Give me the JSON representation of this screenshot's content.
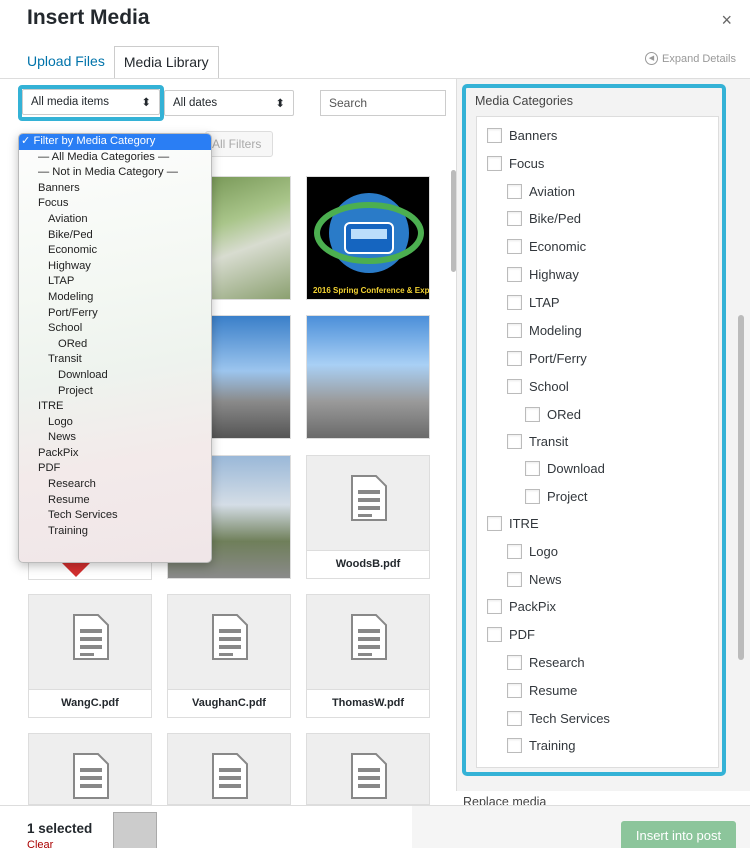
{
  "header": {
    "title": "Insert Media",
    "close": "×"
  },
  "tabs": [
    {
      "label": "Upload Files"
    },
    {
      "label": "Media Library"
    }
  ],
  "expand_details": "Expand Details",
  "toolbar": {
    "media_type": "All media items",
    "date_filter": "All dates",
    "search_placeholder": "Search",
    "filters_button": "All Filters",
    "arrow": "⬍"
  },
  "dropdown": {
    "selected": "✓ Filter by Media Category",
    "items": [
      "— All Media Categories —",
      "— Not in Media Category —",
      "Banners",
      "Focus",
      "Aviation",
      "Bike/Ped",
      "Economic",
      "Highway",
      "LTAP",
      "Modeling",
      "Port/Ferry",
      "School",
      "ORed",
      "Transit",
      "Download",
      "Project",
      "ITRE",
      "Logo",
      "News",
      "PackPix",
      "PDF",
      "Research",
      "Resume",
      "Tech Services",
      "Training"
    ]
  },
  "grid": {
    "pdf_files": [
      "WoodsB.pdf",
      "WangC.pdf",
      "VaughanC.pdf",
      "ThomasW.pdf"
    ],
    "logo_text": "2016 Spring Conference & Expo"
  },
  "categories": {
    "title": "Media Categories",
    "items": [
      "Banners",
      "Focus",
      "Aviation",
      "Bike/Ped",
      "Economic",
      "Highway",
      "LTAP",
      "Modeling",
      "Port/Ferry",
      "School",
      "ORed",
      "Transit",
      "Download",
      "Project",
      "ITRE",
      "Logo",
      "News",
      "PackPix",
      "PDF",
      "Research",
      "Resume",
      "Tech Services",
      "Training"
    ]
  },
  "replace_media": "Replace media",
  "footer": {
    "selected": "1 selected",
    "clear": "Clear",
    "insert": "Insert into post"
  },
  "colors": {
    "highlight": "#34b2d6",
    "link": "#0073aa",
    "insert": "#8cc59b"
  }
}
